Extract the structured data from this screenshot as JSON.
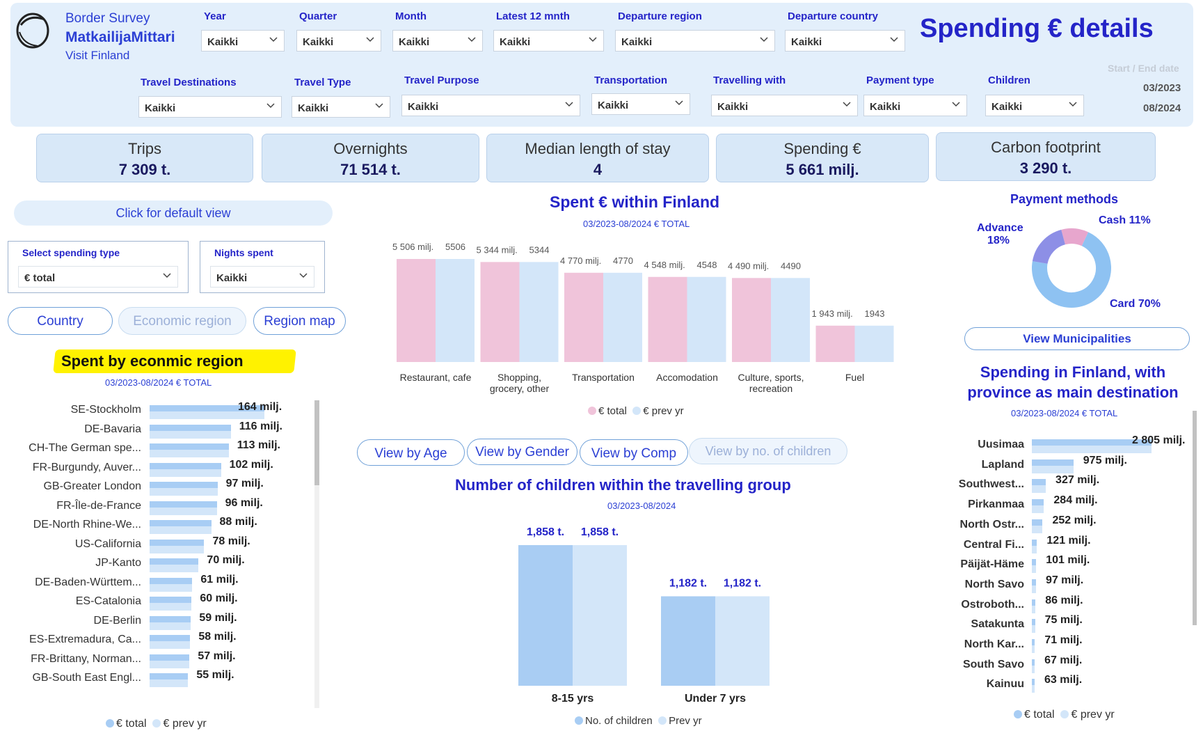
{
  "brand": {
    "line1": "Border Survey",
    "line2": "MatkailijaMittari",
    "line3": "Visit Finland"
  },
  "page_title": "Spending € details",
  "filters": {
    "year": {
      "label": "Year",
      "value": "Kaikki"
    },
    "quarter": {
      "label": "Quarter",
      "value": "Kaikki"
    },
    "month": {
      "label": "Month",
      "value": "Kaikki"
    },
    "latest12": {
      "label": "Latest 12 mnth",
      "value": "Kaikki"
    },
    "departure_region": {
      "label": "Departure region",
      "value": "Kaikki"
    },
    "departure_country": {
      "label": "Departure country",
      "value": "Kaikki"
    },
    "travel_destinations": {
      "label": "Travel Destinations",
      "value": "Kaikki"
    },
    "travel_type": {
      "label": "Travel Type",
      "value": "Kaikki"
    },
    "travel_purpose": {
      "label": "Travel Purpose",
      "value": "Kaikki"
    },
    "transportation": {
      "label": "Transportation",
      "value": "Kaikki"
    },
    "travelling_with": {
      "label": "Travelling with",
      "value": "Kaikki"
    },
    "payment_type": {
      "label": "Payment type",
      "value": "Kaikki"
    },
    "children": {
      "label": "Children",
      "value": "Kaikki"
    }
  },
  "dates": {
    "label": "Start / End date",
    "start": "03/2023",
    "end": "08/2024"
  },
  "kpis": [
    {
      "title": "Trips",
      "value": "7 309 t."
    },
    {
      "title": "Overnights",
      "value": "71 514 t."
    },
    {
      "title": "Median length of stay",
      "value": "4"
    },
    {
      "title": "Spending €",
      "value": "5 661 milj."
    },
    {
      "title": "Carbon footprint",
      "value": "3 290 t."
    }
  ],
  "left": {
    "default_view": "Click for default view",
    "spending_type": {
      "label": "Select spending type",
      "value": "€ total"
    },
    "nights_spent": {
      "label": "Nights spent",
      "value": "Kaikki"
    },
    "toggles": {
      "country": "Country",
      "economic_region": "Economic region",
      "region_map": "Region map"
    }
  },
  "colors": {
    "pink": "#f0c4da",
    "light_blue": "#d3e6f9",
    "mid_blue": "#a9cdf3",
    "bar_blue": "#a8cdf4",
    "title_blue": "#2424c8",
    "highlight": "#fff200"
  },
  "buttons": {
    "view_age": "View by Age",
    "view_gender": "View by Gender",
    "view_comp": "View by Comp",
    "view_children": "View by no. of children",
    "view_municipalities": "View Municipalities"
  },
  "chart_data": [
    {
      "id": "econ_region",
      "type": "bar",
      "orientation": "horizontal",
      "title": "Spent by econmic region",
      "subtitle": "03/2023-08/2024 € TOTAL",
      "unit": "milj.",
      "categories": [
        "SE-Stockholm",
        "DE-Bavaria",
        "CH-The German spe...",
        "FR-Burgundy, Auver...",
        "GB-Greater London",
        "FR-Île-de-France",
        "DE-North Rhine-We...",
        "US-California",
        "JP-Kanto",
        "DE-Baden-Württem...",
        "ES-Catalonia",
        "DE-Berlin",
        "ES-Extremadura, Ca...",
        "FR-Brittany, Norman...",
        "GB-South East Engl..."
      ],
      "values": [
        164,
        116,
        113,
        102,
        97,
        96,
        88,
        78,
        70,
        61,
        60,
        59,
        58,
        57,
        55
      ],
      "value_labels": [
        "164 milj.",
        "116 milj.",
        "113 milj.",
        "102 milj.",
        "97 milj.",
        "96 milj.",
        "88 milj.",
        "78 milj.",
        "70 milj.",
        "61 milj.",
        "60 milj.",
        "59 milj.",
        "58 milj.",
        "57 milj.",
        "55 milj."
      ],
      "legend": [
        "€ total",
        "€ prev yr"
      ]
    },
    {
      "id": "spent_finland",
      "type": "bar",
      "title": "Spent € within Finland",
      "subtitle": "03/2023-08/2024 € TOTAL",
      "categories": [
        "Restaurant, cafe",
        "Shopping, grocery, other",
        "Transportation",
        "Accomodation",
        "Culture, sports, recreation",
        "Fuel"
      ],
      "category_lines": [
        [
          "Restaurant, cafe"
        ],
        [
          "Shopping,",
          "grocery, other"
        ],
        [
          "Transportation"
        ],
        [
          "Accomodation"
        ],
        [
          "Culture, sports,",
          "recreation"
        ],
        [
          "Fuel"
        ]
      ],
      "series": [
        {
          "name": "€ total",
          "values": [
            5506,
            5344,
            4770,
            4548,
            4490,
            1943
          ],
          "labels": [
            "5 506 milj.",
            "5 344 milj.",
            "4 770 milj.",
            "4 548 milj.",
            "4 490 milj.",
            "1 943 milj."
          ]
        },
        {
          "name": "€ prev yr",
          "values": [
            5506,
            5344,
            4770,
            4548,
            4490,
            1943
          ],
          "labels": [
            "5506",
            "5344",
            "4770",
            "4548",
            "4490",
            "1943"
          ]
        }
      ]
    },
    {
      "id": "payment_methods",
      "type": "pie",
      "title": "Payment methods",
      "slices": [
        {
          "label": "Card",
          "value": 70,
          "text": "Card 70%",
          "color": "#8ec2f2"
        },
        {
          "label": "Advance",
          "value": 18,
          "text": "Advance 18%",
          "color": "#8d8fe6"
        },
        {
          "label": "Cash",
          "value": 11,
          "text": "Cash 11%",
          "color": "#e7a6cd"
        }
      ]
    },
    {
      "id": "children_group",
      "type": "bar",
      "title": "Number of children within the travelling group",
      "subtitle": "03/2023-08/2024",
      "categories": [
        "8-15 yrs",
        "Under 7 yrs"
      ],
      "series": [
        {
          "name": "No. of children",
          "values": [
            1858,
            1182
          ],
          "labels": [
            "1,858 t.",
            "1,182 t."
          ]
        },
        {
          "name": "Prev yr",
          "values": [
            1858,
            1182
          ],
          "labels": [
            "1,858 t.",
            "1,182 t."
          ]
        }
      ]
    },
    {
      "id": "province",
      "type": "bar",
      "orientation": "horizontal",
      "title": "Spending in Finland, with province as main destination",
      "title_lines": [
        "Spending in Finland, with",
        "province as main destination"
      ],
      "subtitle": "03/2023-08/2024 € TOTAL",
      "categories": [
        "Uusimaa",
        "Lapland",
        "Southwest...",
        "Pirkanmaa",
        "North Ostr...",
        "Central Fi...",
        "Päijät-Häme",
        "North Savo",
        "Ostroboth...",
        "Satakunta",
        "North Kar...",
        "South Savo",
        "Kainuu"
      ],
      "values": [
        2805,
        975,
        327,
        284,
        252,
        121,
        101,
        97,
        86,
        75,
        71,
        67,
        63
      ],
      "value_labels": [
        "2 805 milj.",
        "975 milj.",
        "327 milj.",
        "284 milj.",
        "252 milj.",
        "121 milj.",
        "101 milj.",
        "97 milj.",
        "86 milj.",
        "75 milj.",
        "71 milj.",
        "67 milj.",
        "63 milj."
      ],
      "legend": [
        "€ total",
        "€ prev yr"
      ]
    }
  ]
}
